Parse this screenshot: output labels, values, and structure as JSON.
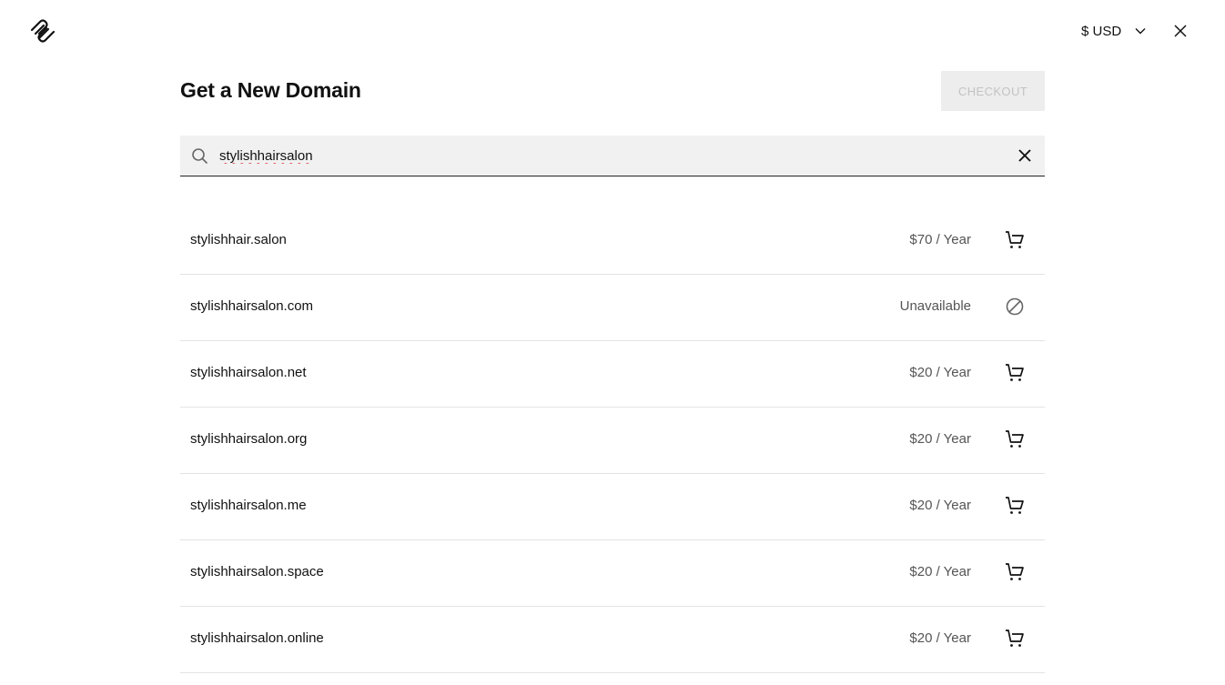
{
  "header": {
    "logo_icon": "squarespace-logo-icon",
    "currency_label": "$ USD",
    "currency_icon": "chevron-down-icon",
    "close_icon": "close-icon"
  },
  "main": {
    "title": "Get a New Domain",
    "checkout_label": "CHECKOUT"
  },
  "search": {
    "icon": "search-icon",
    "value": "stylishhairsalon",
    "clear_icon": "clear-icon"
  },
  "results": [
    {
      "domain": "stylishhair.salon",
      "price": "$70 / Year",
      "action_icon": "cart-icon"
    },
    {
      "domain": "stylishhairsalon.com",
      "price": "Unavailable",
      "action_icon": "unavailable-icon"
    },
    {
      "domain": "stylishhairsalon.net",
      "price": "$20 / Year",
      "action_icon": "cart-icon"
    },
    {
      "domain": "stylishhairsalon.org",
      "price": "$20 / Year",
      "action_icon": "cart-icon"
    },
    {
      "domain": "stylishhairsalon.me",
      "price": "$20 / Year",
      "action_icon": "cart-icon"
    },
    {
      "domain": "stylishhairsalon.space",
      "price": "$20 / Year",
      "action_icon": "cart-icon"
    },
    {
      "domain": "stylishhairsalon.online",
      "price": "$20 / Year",
      "action_icon": "cart-icon"
    }
  ],
  "colors": {
    "checkout_bg": "#ededed",
    "checkout_text": "#c3c3c3",
    "search_bg": "#f1f1f1",
    "price_text": "#555555"
  }
}
